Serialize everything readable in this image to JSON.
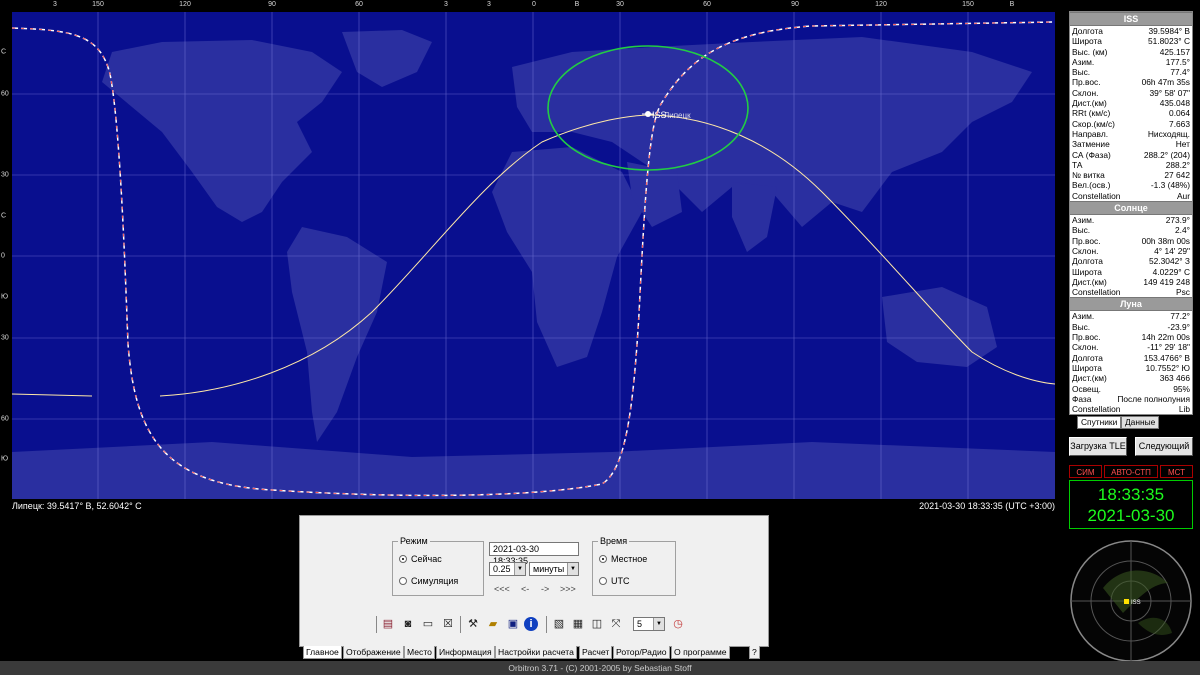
{
  "top_scale": [
    "3",
    "150",
    "120",
    "90",
    "60",
    "3",
    "3",
    "0",
    "В",
    "30",
    "60",
    "90",
    "120",
    "150",
    "В"
  ],
  "left_scale": [
    "С",
    "60",
    "30",
    "С",
    "0",
    "Ю",
    "30",
    "60",
    "Ю"
  ],
  "map": {
    "satellite_label": "ISS",
    "observer_label": "Липецк"
  },
  "status": {
    "observer_coords": "Липецк: 39.5417° В, 52.6042° С",
    "datetime": "2021-03-30 18:33:35 (UTC +3:00)"
  },
  "iss": {
    "title": "ISS",
    "rows": [
      [
        "Долгота",
        "39.5984° В"
      ],
      [
        "Широта",
        "51.8023° С"
      ],
      [
        "Выс. (км)",
        "425.157"
      ],
      [
        "Азим.",
        "177.5°"
      ],
      [
        "Выс.",
        "77.4°"
      ],
      [
        "Пр.вос.",
        "06h 47m 35s"
      ],
      [
        "Склон.",
        "39° 58' 07\""
      ],
      [
        "Дист.(км)",
        "435.048"
      ],
      [
        "RRt (км/с)",
        "0.064"
      ],
      [
        "Скор.(км/с)",
        "7.663"
      ],
      [
        "Направл.",
        "Нисходящ."
      ],
      [
        "Затмение",
        "Нет"
      ],
      [
        "СА (Фаза)",
        "288.2° (204)"
      ],
      [
        "ТА",
        "288.2°"
      ],
      [
        "№ витка",
        "27 642"
      ],
      [
        "Вел.(осв.)",
        "-1.3 (48%)"
      ],
      [
        "Constellation",
        "Aur"
      ]
    ]
  },
  "sun": {
    "title": "Солнце",
    "rows": [
      [
        "Азим.",
        "273.9°"
      ],
      [
        "Выс.",
        "2.4°"
      ],
      [
        "Пр.вос.",
        "00h 38m 00s"
      ],
      [
        "Склон.",
        "4° 14' 29\""
      ],
      [
        "Долгота",
        "52.3042° З"
      ],
      [
        "Широта",
        "4.0229° С"
      ],
      [
        "Дист.(км)",
        "149 419 248"
      ],
      [
        "Constellation",
        "Psc"
      ]
    ]
  },
  "moon": {
    "title": "Луна",
    "rows": [
      [
        "Азим.",
        "77.2°"
      ],
      [
        "Выс.",
        "-23.9°"
      ],
      [
        "Пр.вос.",
        "14h 22m 00s"
      ],
      [
        "Склон.",
        "-11° 29' 18\""
      ],
      [
        "Долгота",
        "153.4766° В"
      ],
      [
        "Широта",
        "10.7552° Ю"
      ],
      [
        "Дист.(км)",
        "363 466"
      ],
      [
        "Освещ.",
        "95%"
      ],
      [
        "Фаза",
        "После полнолуния"
      ],
      [
        "Constellation",
        "Lib"
      ]
    ]
  },
  "panel_tabs": [
    "Спутники",
    "Данные"
  ],
  "buttons": {
    "load_tle": "Загрузка TLE",
    "next": "Следующий"
  },
  "clock": {
    "tabs": [
      "СИМ",
      "АВТО-СТП",
      "МСТ"
    ],
    "time": "18:33:35",
    "date": "2021-03-30"
  },
  "radar": {
    "label": "ISS"
  },
  "control": {
    "mode_title": "Режим",
    "mode_now": "Сейчас",
    "mode_sim": "Симуляция",
    "datetime_field": "2021-03-30 18:33:35",
    "step_value": "0.25",
    "step_unit": "минуты",
    "step_buttons": [
      "<<<",
      "<-",
      "->",
      ">>>"
    ],
    "time_title": "Время",
    "time_local": "Местное",
    "time_utc": "UTC",
    "zoom_value": "5"
  },
  "bottom_tabs": [
    "Главное",
    "Отображение",
    "Место",
    "Информация",
    "Настройки расчета",
    "Расчет",
    "Ротор/Радио",
    "О программе",
    "?"
  ],
  "footer": "Orbitron 3.71 - (C) 2001-2005 by Sebastian Stoff",
  "colors": {
    "map_ocean": "#0b10a8",
    "map_land": "#2a2fa0",
    "night_area": "#0a0e7a",
    "clock_green": "#1dfc1d",
    "orbit_track": "#ffe8a8"
  }
}
